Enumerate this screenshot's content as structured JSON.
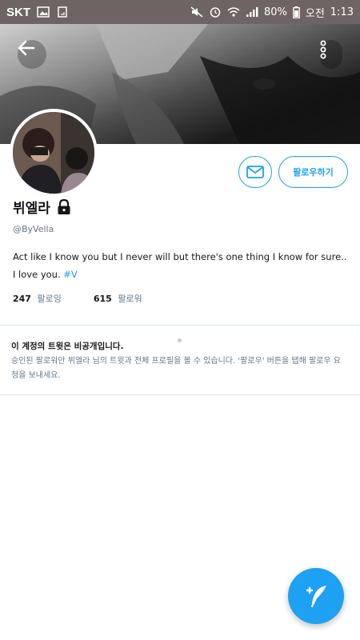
{
  "status_bar": {
    "carrier": "SKT",
    "battery": "80%",
    "time_prefix": "오전",
    "time": "1:13"
  },
  "header": {
    "back_icon": "arrow-left-icon",
    "more_icon": "vertical-dots-icon"
  },
  "profile": {
    "display_name": "뷔엘라",
    "lock_icon": "lock-icon",
    "handle": "@ByVella",
    "bio_text": "Act like I know you but I never will but there's one thing I know for sure.. I love you.",
    "bio_hashtag": "#V",
    "following_count": "247",
    "following_label": "팔로잉",
    "followers_count": "615",
    "followers_label": "팔로워"
  },
  "actions": {
    "dm_icon": "envelope-icon",
    "follow_label": "팔로우하기"
  },
  "private_notice": {
    "title": "이 계정의 트윗은 비공개입니다.",
    "description": "승인된 팔로워만 뷔엘라 님의 트윗과 전체 프로필을 볼 수 있습니다. '팔로우' 버튼을 탭해 팔로우 요청을 보내세요."
  },
  "compose": {
    "icon": "compose-quill-icon"
  },
  "colors": {
    "accent": "#1da1f2",
    "status_bar": "#6e6464",
    "secondary_text": "#657786"
  }
}
